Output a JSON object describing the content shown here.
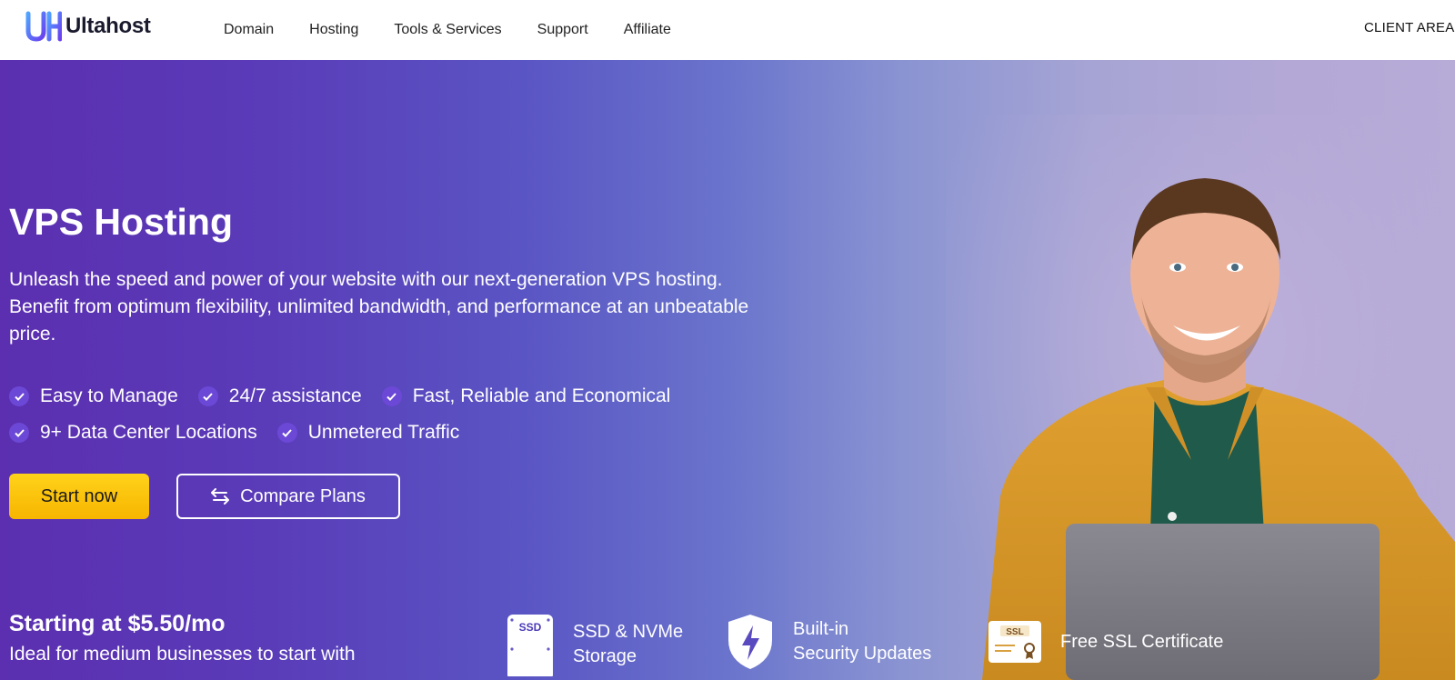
{
  "brand": {
    "name": "Ultahost",
    "accent": "#4f46e5"
  },
  "nav": {
    "items": [
      {
        "label": "Domain"
      },
      {
        "label": "Hosting"
      },
      {
        "label": "Tools & Services"
      },
      {
        "label": "Support"
      },
      {
        "label": "Affiliate"
      }
    ],
    "client_area": "CLIENT AREA"
  },
  "hero": {
    "title": "VPS Hosting",
    "description": "Unleash the speed and power of your website with our next-generation VPS hosting. Benefit from optimum flexibility, unlimited bandwidth, and performance at an unbeatable price.",
    "features": [
      "Easy to Manage",
      "24/7 assistance",
      "Fast, Reliable and Economical",
      "9+ Data Center Locations",
      "Unmetered Traffic"
    ],
    "start_button": "Start now",
    "compare_button": "Compare Plans",
    "price": "Starting at $5.50/mo",
    "ideal": "Ideal for medium businesses to start with",
    "start_color": "#ffc107"
  },
  "badges": {
    "ssd": {
      "icon_text": "SSD",
      "line1": "SSD & NVMe",
      "line2": "Storage"
    },
    "security": {
      "line1": "Built-in",
      "line2": "Security Updates"
    },
    "ssl": {
      "icon_text": "SSL",
      "label": "Free SSL Certificate"
    }
  }
}
